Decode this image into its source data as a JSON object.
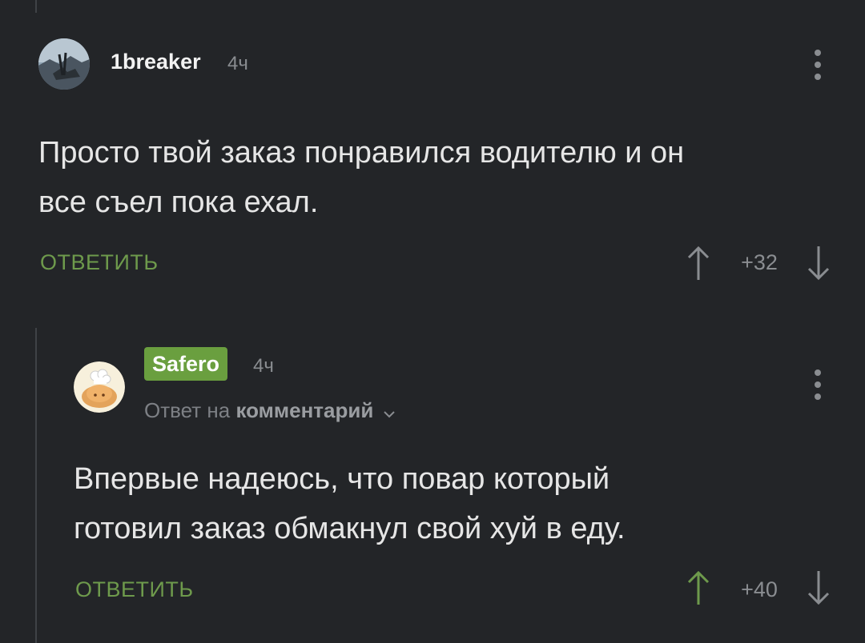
{
  "comment1": {
    "username": "1breaker",
    "time": "4ч",
    "text_line1": "Просто твой заказ понравился водителю и он",
    "text_line2": "все съел пока ехал.",
    "reply_label": "ОТВЕТИТЬ",
    "rating": "+32"
  },
  "comment2": {
    "username": "Safero",
    "time": "4ч",
    "reply_to_prefix": "Ответ на",
    "reply_to_target": "комментарий",
    "text_line1": "Впервые надеюсь, что повар который",
    "text_line2": "готовил заказ обмакнул свой хуй в еду.",
    "reply_label": "ОТВЕТИТЬ",
    "rating": "+40"
  },
  "colors": {
    "background": "#232528",
    "accent_green": "#6e9a4c",
    "badge_green": "#6a9f3f",
    "muted": "#8a8d91"
  }
}
